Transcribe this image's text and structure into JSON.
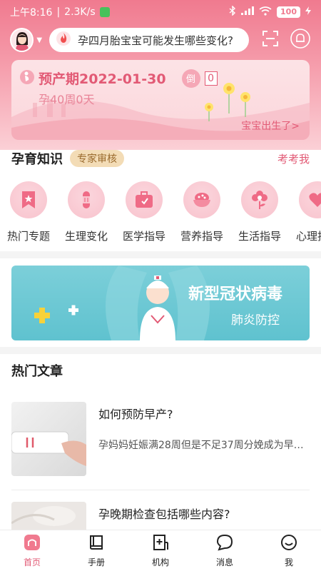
{
  "status_bar": {
    "time": "上午8:16",
    "speed": "2.3K/s",
    "battery": "100"
  },
  "search": {
    "placeholder": "孕四月胎宝宝可能发生哪些变化?"
  },
  "due_card": {
    "due_label": "预产期2022-01-30",
    "countdown_label": "倒",
    "countdown_value": "0",
    "week_text": "孕40周0天",
    "born_link": "宝宝出生了>"
  },
  "knowledge": {
    "title": "孕育知识",
    "badge": "专家审核",
    "quiz_link": "考考我",
    "categories": [
      {
        "label": "热门专题",
        "icon": "bookmark-star-icon"
      },
      {
        "label": "生理变化",
        "icon": "bandage-icon"
      },
      {
        "label": "医学指导",
        "icon": "medical-kit-icon"
      },
      {
        "label": "营养指导",
        "icon": "food-bowl-icon"
      },
      {
        "label": "生活指导",
        "icon": "flower-icon"
      },
      {
        "label": "心理指导",
        "icon": "heart-icon"
      }
    ]
  },
  "banner": {
    "title": "新型冠状病毒",
    "subtitle": "肺炎防控"
  },
  "articles": {
    "title": "热门文章",
    "items": [
      {
        "title": "如何预防早产?",
        "summary": "孕妈妈妊娠满28周但是不足37周分娩成为早产…"
      },
      {
        "title": "孕晚期检查包括哪些内容?",
        "summary": ""
      }
    ]
  },
  "bottom_nav": [
    {
      "label": "首页",
      "icon": "home-icon",
      "active": true
    },
    {
      "label": "手册",
      "icon": "book-icon",
      "active": false
    },
    {
      "label": "机构",
      "icon": "hospital-icon",
      "active": false
    },
    {
      "label": "消息",
      "icon": "message-icon",
      "active": false
    },
    {
      "label": "我",
      "icon": "smile-icon",
      "active": false
    }
  ],
  "colors": {
    "brand": "#e25a75",
    "header_top": "#f07a8f",
    "banner": "#5fc2cf"
  }
}
